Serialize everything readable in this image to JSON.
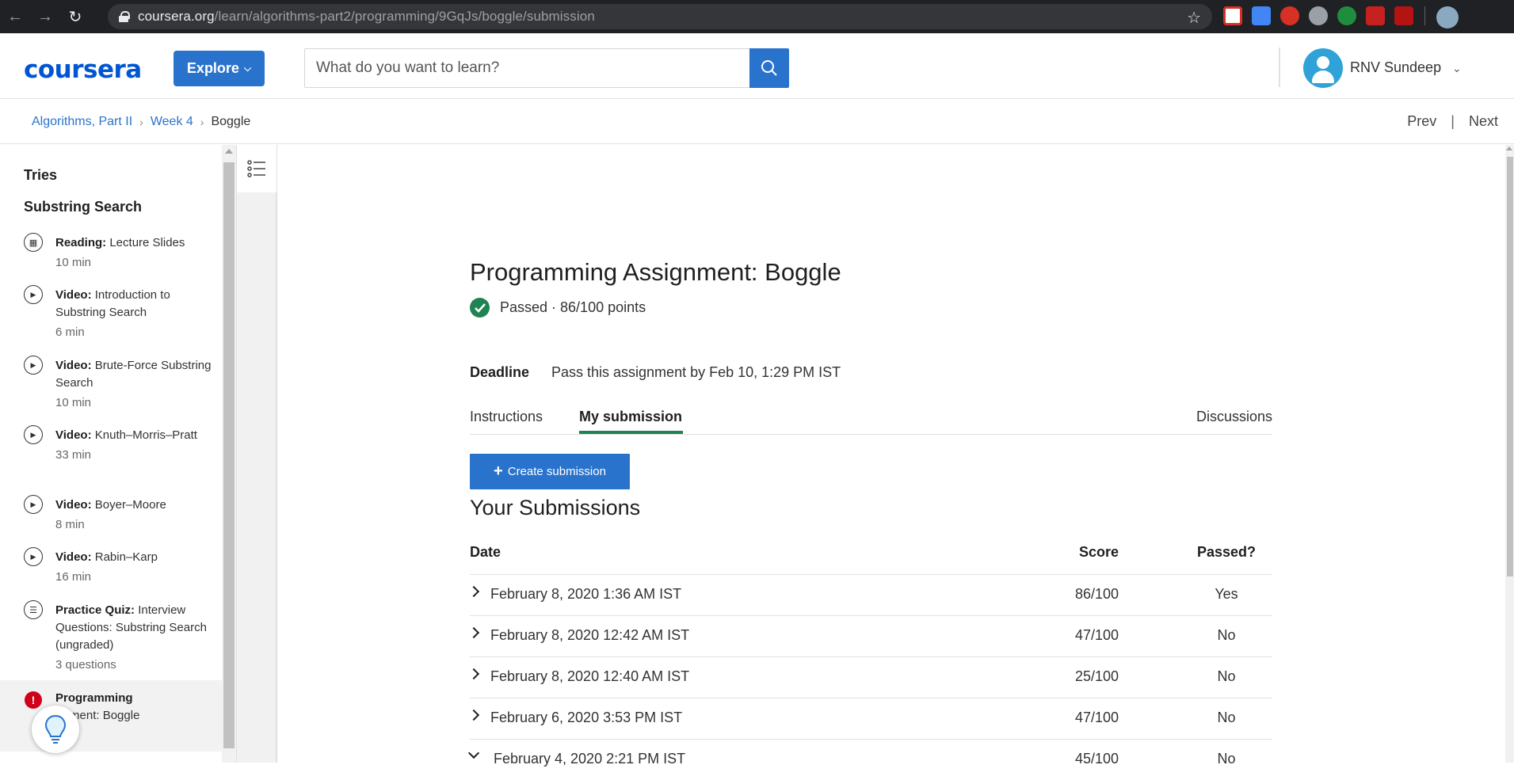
{
  "browser": {
    "url_host": "coursera.org",
    "url_path": "/learn/algorithms-part2/programming/9GqJs/boggle/submission"
  },
  "header": {
    "logo_text": "coursera",
    "explore_label": "Explore",
    "search_placeholder": "What do you want to learn?",
    "user_name": "RNV Sundeep",
    "brand_color": "#2a73cc"
  },
  "breadcrumb": {
    "items": [
      "Algorithms, Part II",
      "Week 4"
    ],
    "current": "Boggle"
  },
  "pager": {
    "prev": "Prev",
    "next": "Next"
  },
  "sidebar": {
    "section_tries": "Tries",
    "section_title": "Substring Search",
    "items": [
      {
        "type": "Reading:",
        "name": "Lecture Slides",
        "meta": "10 min",
        "icon": "book-icon"
      },
      {
        "type": "Video:",
        "name": "Introduction to Substring Search",
        "meta": "6 min",
        "icon": "play-icon"
      },
      {
        "type": "Video:",
        "name": "Brute-Force Substring Search",
        "meta": "10 min",
        "icon": "play-icon"
      },
      {
        "type": "Video:",
        "name": "Knuth–Morris–Pratt",
        "meta": "33 min",
        "icon": "play-icon"
      },
      {
        "type": "Video:",
        "name": "Boyer–Moore",
        "meta": "8 min",
        "icon": "play-icon"
      },
      {
        "type": "Video:",
        "name": "Rabin–Karp",
        "meta": "16 min",
        "icon": "play-icon"
      },
      {
        "type": "Practice Quiz:",
        "name": "Interview Questions: Substring Search (ungraded)",
        "meta": "3 questions",
        "icon": "quiz-icon"
      },
      {
        "type": "Programming",
        "name": "ignment: Boggle",
        "meta": "",
        "icon": "error-icon"
      }
    ]
  },
  "main": {
    "title": "Programming Assignment: Boggle",
    "status": "Passed · 86/100 points",
    "deadline_label": "Deadline",
    "deadline_value": "Pass this assignment by Feb 10, 1:29 PM IST",
    "tabs": [
      "Instructions",
      "My submission",
      "Discussions"
    ],
    "create_label": "Create submission",
    "submissions_title": "Your Submissions",
    "columns": [
      "Date",
      "Score",
      "Passed?"
    ],
    "rows": [
      {
        "date": "February 8, 2020 1:36 AM IST",
        "score": "86/100",
        "passed": "Yes"
      },
      {
        "date": "February 8, 2020 12:42 AM IST",
        "score": "47/100",
        "passed": "No"
      },
      {
        "date": "February 8, 2020 12:40 AM IST",
        "score": "25/100",
        "passed": "No"
      },
      {
        "date": "February 6, 2020 3:53 PM IST",
        "score": "47/100",
        "passed": "No"
      },
      {
        "date": "February 4, 2020 2:21 PM IST",
        "score": "45/100",
        "passed": "No"
      }
    ]
  }
}
